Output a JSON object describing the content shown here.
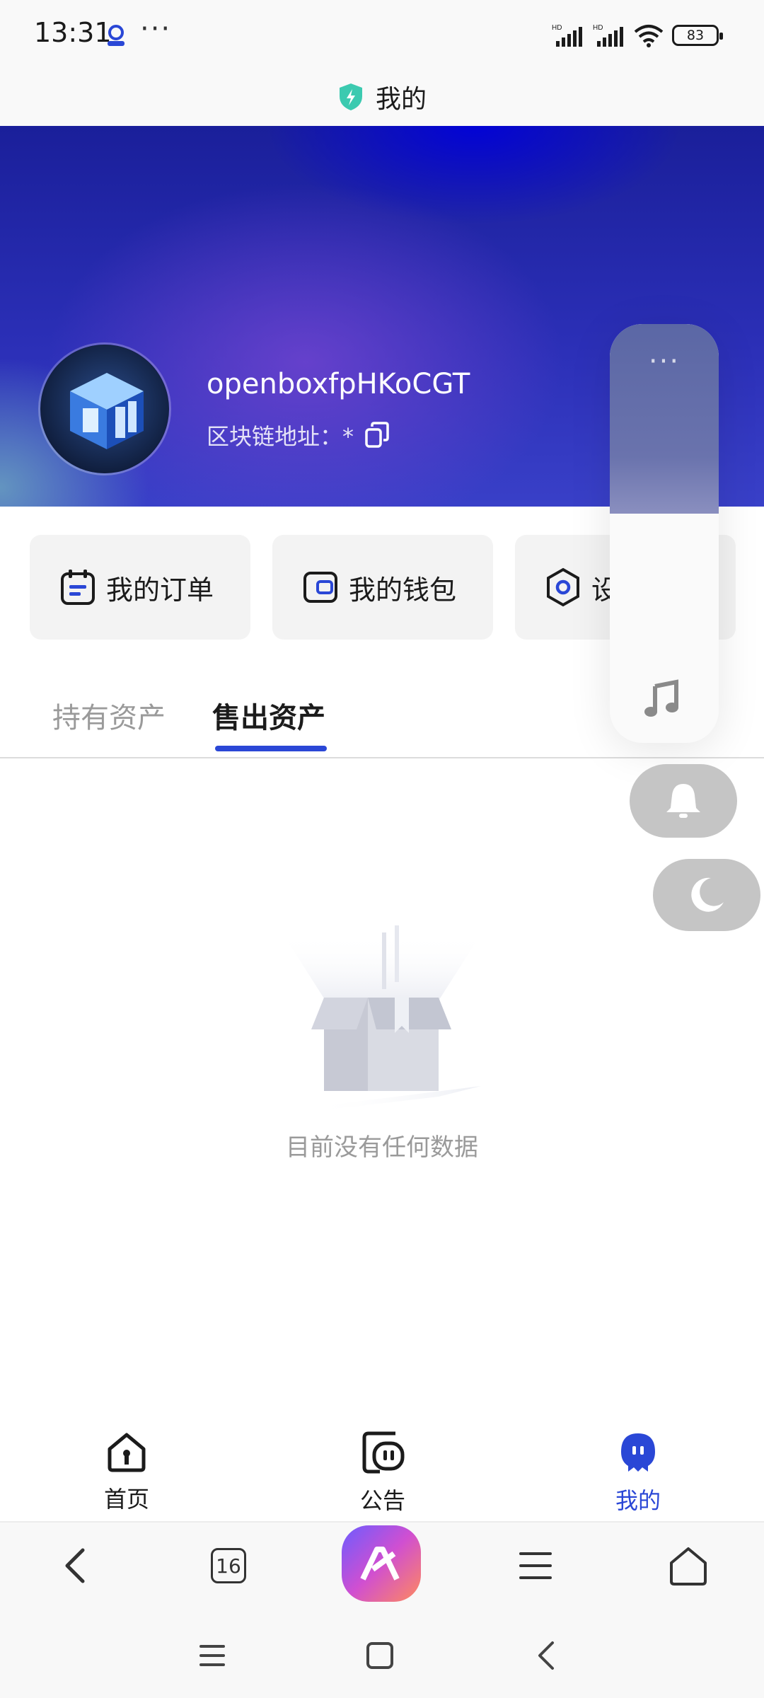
{
  "status_bar": {
    "time": "13:31",
    "more": "···",
    "signal_label_1": "HD",
    "signal_label_2": "HD",
    "battery": "83"
  },
  "header": {
    "title": "我的",
    "icon": "shield-bolt-icon"
  },
  "profile": {
    "username": "openboxfpHKoCGT",
    "chain_label": "区块链地址：*",
    "copy_icon": "copy-icon"
  },
  "quick_actions": [
    {
      "label": "我的订单",
      "icon": "order-icon"
    },
    {
      "label": "我的钱包",
      "icon": "wallet-icon"
    },
    {
      "label": "设",
      "icon": "settings-icon"
    }
  ],
  "tabs": [
    {
      "label": "持有资产",
      "active": false
    },
    {
      "label": "售出资产",
      "active": true
    }
  ],
  "empty_state": {
    "message": "目前没有任何数据"
  },
  "floating_panel": {
    "more": "···",
    "buttons": [
      "music-icon",
      "bell-icon",
      "moon-icon"
    ]
  },
  "bottom_nav": [
    {
      "label": "首页",
      "icon": "home-icon",
      "active": false
    },
    {
      "label": "公告",
      "icon": "announcement-icon",
      "active": false
    },
    {
      "label": "我的",
      "icon": "profile-icon",
      "active": true
    }
  ],
  "browser_bar": {
    "tab_count": "16"
  },
  "colors": {
    "accent": "#2a47d6",
    "inactive_text": "#9a9a9a"
  }
}
